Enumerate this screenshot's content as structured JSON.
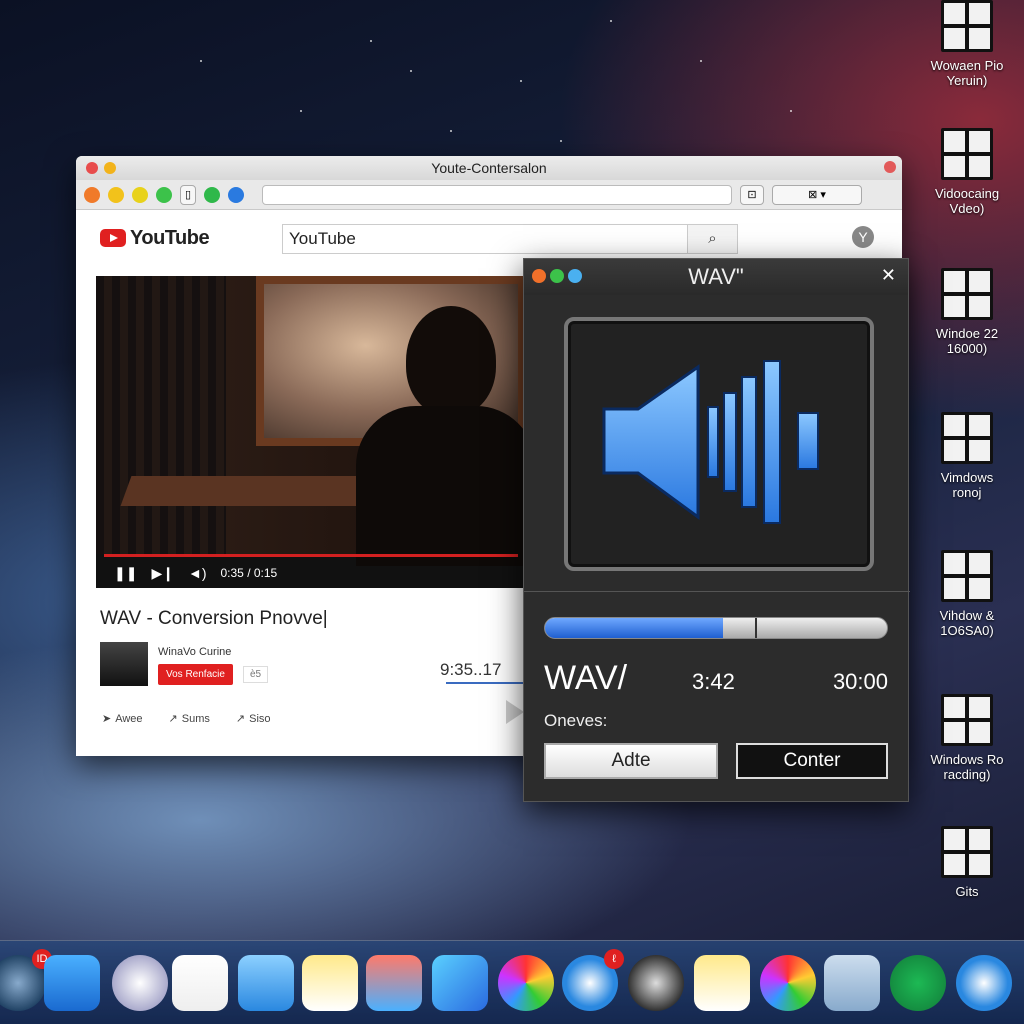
{
  "browser": {
    "window_title": "Youte-Contersalon",
    "address_text": "",
    "yt_logo_text": "YouTube",
    "search_value": "YouTube",
    "search_icon": "search-icon",
    "avatar_letter": "Y",
    "player": {
      "time": "0:35 / 0:15",
      "progress": 1.0
    },
    "video_title": "WAV - Conversion Pnovve|",
    "channel_name": "WinaVo Curine",
    "subscribe_label": "Vos Renfacie",
    "sub_count": "ѐ5",
    "timecode": "9:35..17",
    "actions": [
      "Awee",
      "Sums",
      "Siso"
    ]
  },
  "wav_panel": {
    "title": "WAV\"",
    "big_label": "WAV/",
    "time_current": "3:42",
    "time_total": "30:00",
    "progress": 0.52,
    "options_label": "Oneves:",
    "button_left": "Adte",
    "button_right": "Conter",
    "accent": "#3a8cf0"
  },
  "desktop_icons": [
    {
      "line1": "Wowaen Pio",
      "line2": "Yeruin)"
    },
    {
      "line1": "Vidoocaing",
      "line2": "Vdeo)"
    },
    {
      "line1": "Windoe 22",
      "line2": "16000)"
    },
    {
      "line1": "Vimdows",
      "line2": "ronoj"
    },
    {
      "line1": "Vihdow &",
      "line2": "1O6SA0)"
    },
    {
      "line1": "Windows Ro",
      "line2": "racding)"
    },
    {
      "line1": "Gits",
      "line2": ""
    }
  ],
  "dock": {
    "badge_1": "ID",
    "badge_2": "ℓ"
  }
}
